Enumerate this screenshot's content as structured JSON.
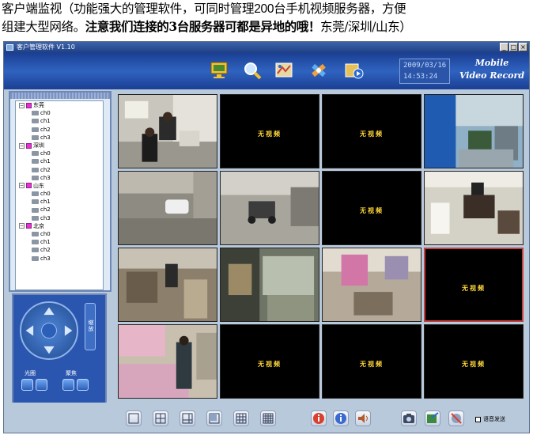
{
  "caption": {
    "line1_part1": "客户端监视（功能强大的管理软件，可同时管理",
    "line1_num": "200",
    "line1_part2": "台手机视频服务器，方便",
    "line2_part1": "组建大型网络。",
    "line2_bold": "注意我们连接的3台服务器可都是异地的哦！",
    "line2_part2": "东莞/深圳/山东）"
  },
  "window": {
    "title": "客户管理软件 V1.10",
    "controls": [
      "_",
      "□",
      "×"
    ]
  },
  "toolbar": {
    "icons": [
      "monitor-icon",
      "search-icon",
      "map-icon",
      "settings-icon",
      "playback-icon"
    ],
    "date": "2009/03/16",
    "time": "14:53:24",
    "brand_line1": "Mobile",
    "brand_line2": "Video Record"
  },
  "tree": {
    "groups": [
      {
        "name": "东莞",
        "channels": [
          "ch0",
          "ch1",
          "ch2",
          "ch3"
        ]
      },
      {
        "name": "深圳",
        "channels": [
          "ch0",
          "ch1",
          "ch2",
          "ch3"
        ]
      },
      {
        "name": "山东",
        "channels": [
          "ch0",
          "ch1",
          "ch2",
          "ch3"
        ]
      },
      {
        "name": "北京",
        "channels": [
          "ch0",
          "ch1",
          "ch2",
          "ch3"
        ]
      }
    ]
  },
  "ptz": {
    "zoom_label": "缩放",
    "iris_label": "光圈",
    "focus_label": "聚焦"
  },
  "video": {
    "no_video_label": "无视频"
  },
  "bottom": {
    "layout_icons": [
      "layout-1-icon",
      "layout-4-icon",
      "layout-6-icon",
      "layout-8-icon",
      "layout-9-icon",
      "layout-16-icon"
    ],
    "voice_label": "语音发送"
  },
  "colors": {
    "toolbar": "#2f63c0",
    "panel": "#b9c9dc",
    "no_video_text": "#ffd83a",
    "selected_cell": "#c74040"
  }
}
